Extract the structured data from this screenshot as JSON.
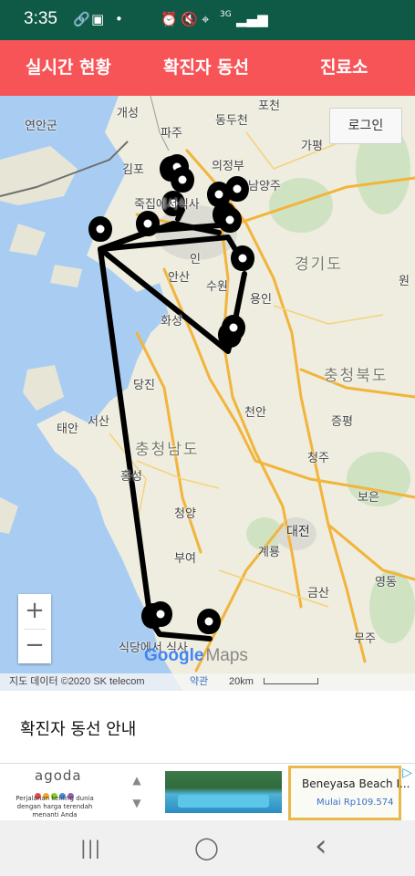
{
  "status_bar": {
    "time": "3:35",
    "left_icons": [
      "link-icon",
      "image-icon",
      "dot-icon"
    ],
    "right_icons": [
      "alarm-icon",
      "mute-icon",
      "location-icon",
      "network-3g-icon",
      "signal-icon",
      "battery-icon"
    ],
    "network_label": "3G"
  },
  "tabs": [
    {
      "label": "실시간 현황"
    },
    {
      "label": "확진자 동선"
    },
    {
      "label": "진료소"
    }
  ],
  "map": {
    "login_label": "로그인",
    "labels": {
      "pocheon": "포천",
      "gaeseong": "개성",
      "yeonan": "연안군",
      "paju": "파주",
      "dongducheon": "동두천",
      "gapyeong": "가평",
      "gimpo": "김포",
      "uijeongbu": "의정부",
      "namyangju": "남양주",
      "jukjip": "죽집에서식사",
      "gyeonggi": "경기도",
      "ansan": "안산",
      "suwon": "수원",
      "yongin": "용인",
      "hwaseong": "화성",
      "dangjin": "당진",
      "chungbuk": "충청북도",
      "taean": "태안",
      "seosan": "서산",
      "cheonan": "천안",
      "jeungpyeong": "증평",
      "chungnam": "충청남도",
      "cheongju": "청주",
      "hongseong": "홍성",
      "boeun": "보은",
      "cheongyang": "청양",
      "daejeon": "대전",
      "buyeo": "부여",
      "gyeryong": "계룡",
      "geumsan": "금산",
      "yeongdong": "영동",
      "sikdang": "식당에서 식사",
      "muju": "무주",
      "won": "원",
      "in": "인"
    },
    "zoom_in": "+",
    "zoom_out": "−",
    "google_logo": "Google",
    "google_maps": "Maps",
    "attribution": "지도 데이터 ©2020 SK telecom",
    "terms": "약관",
    "scale": "20km"
  },
  "section_title": "확진자 동선 안내",
  "ad": {
    "brand": "agoda",
    "brand_dot_colors": [
      "#e5484d",
      "#f5a623",
      "#7ed321",
      "#4a90e2",
      "#9b59b6"
    ],
    "tagline": "Perjalanan keliling dunia dengan harga terendah menanti Anda",
    "hotel_name": "Beneyasa Beach I...",
    "price": "Mulai Rp109.574",
    "up_arrow": "▲",
    "down_arrow": "▼",
    "adchoices": "▷"
  },
  "nav_bar": {
    "recents": "|||",
    "home": "◯",
    "back": "‹"
  },
  "colors": {
    "status_bar": "#0e5a47",
    "tab_bar": "#f75458",
    "route": "#000000",
    "sea": "#a9cdf2",
    "road": "#f2b43a"
  }
}
